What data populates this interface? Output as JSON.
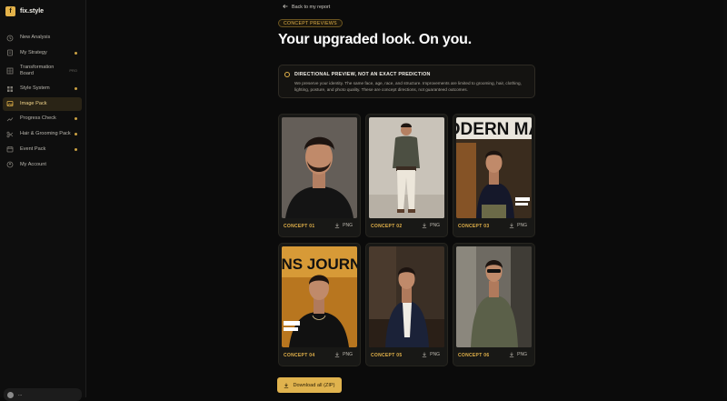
{
  "brand": {
    "logo_text": "f",
    "name": "fix.style"
  },
  "sidebar": {
    "items": [
      {
        "label": "New Analysis",
        "icon": "history-icon"
      },
      {
        "label": "My Strategy",
        "icon": "document-icon",
        "dot": true
      },
      {
        "label": "Transformation Board",
        "icon": "board-icon",
        "badge": "PRO"
      },
      {
        "label": "Style System",
        "icon": "grid-icon",
        "dot": true
      },
      {
        "label": "Image Pack",
        "icon": "image-icon",
        "active": true
      },
      {
        "label": "Progress Check",
        "icon": "trend-icon",
        "dot": true
      },
      {
        "label": "Hair & Grooming Pack",
        "icon": "scissors-icon",
        "dot": true
      },
      {
        "label": "Event Pack",
        "icon": "calendar-icon",
        "dot": true
      },
      {
        "label": "My Account",
        "icon": "user-icon"
      }
    ],
    "account_email": "..."
  },
  "header": {
    "back_label": "Back to my report",
    "eyebrow": "CONCEPT PREVIEWS",
    "title": "Your upgraded look. On you."
  },
  "notice": {
    "title": "DIRECTIONAL PREVIEW, NOT AN EXACT PREDICTION",
    "body": "We preserve your identity. The same face, age, race, and structure. Improvements are limited to grooming, hair, clothing, lighting, posture, and photo quality. These are concept directions, not guaranteed outcomes."
  },
  "concepts": [
    {
      "label": "CONCEPT 01",
      "download": "PNG",
      "scene": "portrait"
    },
    {
      "label": "CONCEPT 02",
      "download": "PNG",
      "scene": "studio-full-body"
    },
    {
      "label": "CONCEPT 03",
      "download": "PNG",
      "scene": "magazine-cover",
      "cover_text": "ODERN MA"
    },
    {
      "label": "CONCEPT 04",
      "download": "PNG",
      "scene": "magazine-cover",
      "cover_text": "IENS JOURNA"
    },
    {
      "label": "CONCEPT 05",
      "download": "PNG",
      "scene": "suit-indoor"
    },
    {
      "label": "CONCEPT 06",
      "download": "PNG",
      "scene": "outdoor-shirt"
    }
  ],
  "actions": {
    "download_all": "Download all (ZIP)"
  },
  "colors": {
    "accent": "#e3b24a",
    "background": "#0b0b0b",
    "card": "#181816"
  }
}
